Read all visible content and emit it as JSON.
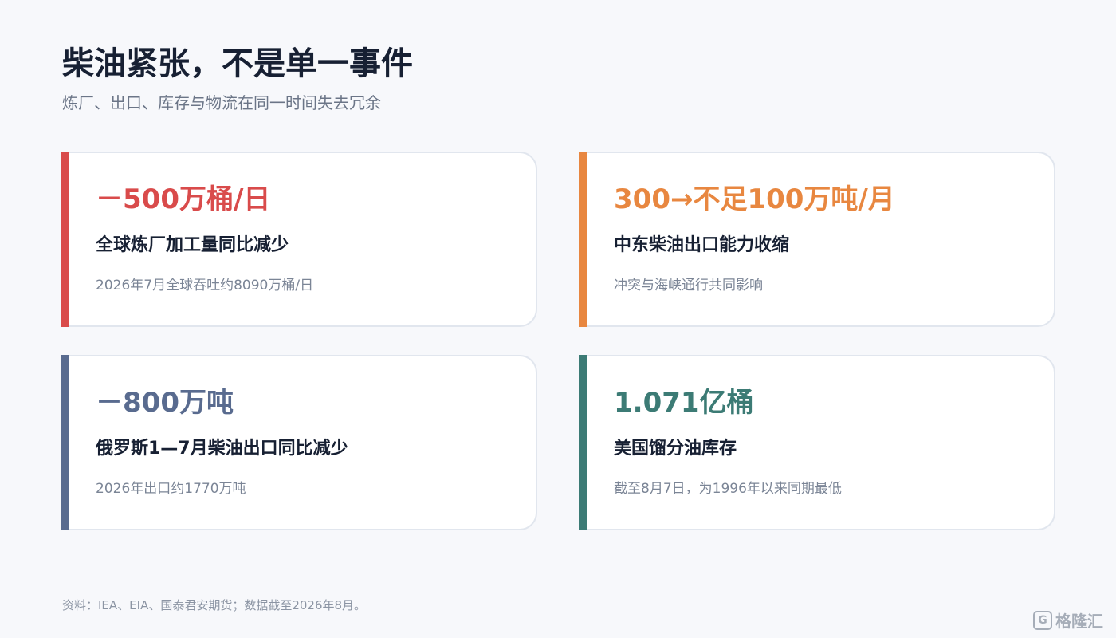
{
  "header": {
    "title": "柴油紧张，不是单一事件",
    "subtitle": "炼厂、出口、库存与物流在同一时间失去冗余"
  },
  "cards": [
    {
      "metric": "－500万桶/日",
      "label": "全球炼厂加工量同比减少",
      "note": "2026年7月全球吞吐约8090万桶/日",
      "color": "#d94b4b"
    },
    {
      "metric": "300→不足100万吨/月",
      "label": "中东柴油出口能力收缩",
      "note": "冲突与海峡通行共同影响",
      "color": "#e88740"
    },
    {
      "metric": "－800万吨",
      "label": "俄罗斯1—7月柴油出口同比减少",
      "note": "2026年出口约1770万吨",
      "color": "#596b8f"
    },
    {
      "metric": "1.071亿桶",
      "label": "美国馏分油库存",
      "note": "截至8月7日，为1996年以来同期最低",
      "color": "#3c7b75"
    }
  ],
  "footer": {
    "source": "资料：IEA、EIA、国泰君安期货；数据截至2026年8月。"
  },
  "watermark": {
    "text": "格隆汇",
    "icon": "brand-logo-icon"
  }
}
